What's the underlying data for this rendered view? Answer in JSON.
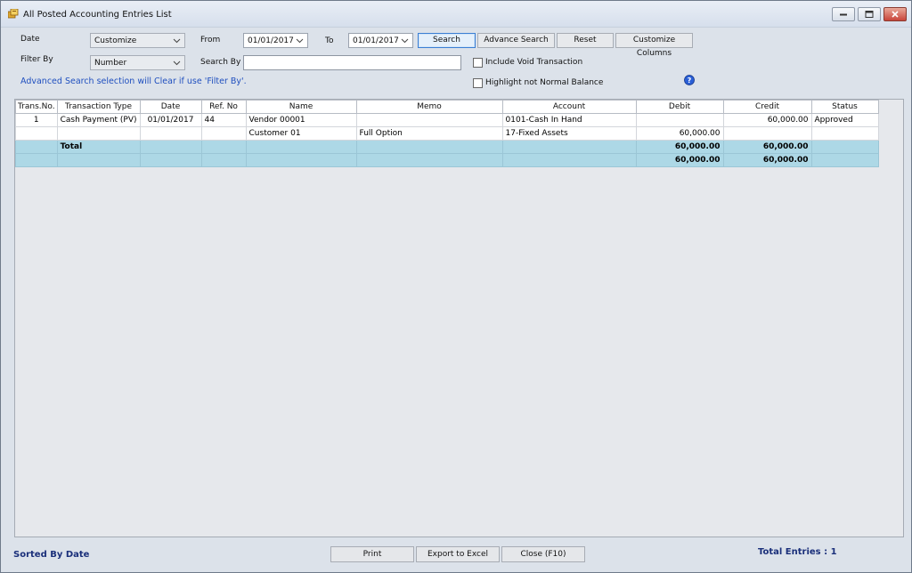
{
  "window": {
    "title": "All Posted Accounting Entries List",
    "colors": {
      "total_row": "#add8e6",
      "link": "#1f4fbf",
      "status_text": "#1a2f7a"
    }
  },
  "filters": {
    "date_label": "Date",
    "date_value": "Customize",
    "from_label": "From",
    "from_value": "01/01/2017",
    "to_label": "To",
    "to_value": "01/01/2017",
    "search_button": "Search",
    "advance_search_button": "Advance Search",
    "reset_button": "Reset",
    "customize_columns_button": "Customize Columns",
    "filter_by_label": "Filter By",
    "filter_by_value": "Number",
    "search_by_label": "Search By",
    "search_by_value": "",
    "include_void_label": "Include Void Transaction",
    "include_void_checked": false,
    "highlight_label": "Highlight not Normal Balance",
    "highlight_checked": false,
    "advanced_note": "Advanced Search selection will Clear if use 'Filter By'."
  },
  "grid": {
    "columns": [
      "Trans.No.",
      "Transaction Type",
      "Date",
      "Ref. No",
      "Name",
      "Memo",
      "Account",
      "Debit",
      "Credit",
      "Status"
    ],
    "rows": [
      {
        "trans_no": "1",
        "type": "Cash Payment (PV)",
        "date": "01/01/2017",
        "ref": "44",
        "name": "Vendor 00001",
        "memo": "",
        "account": "0101-Cash In Hand",
        "debit": "",
        "credit": "60,000.00",
        "status": "Approved"
      },
      {
        "trans_no": "",
        "type": "",
        "date": "",
        "ref": "",
        "name": "Customer 01",
        "memo": "Full Option",
        "account": "17-Fixed Assets",
        "debit": "60,000.00",
        "credit": "",
        "status": ""
      }
    ],
    "total_label": "Total",
    "totals": [
      {
        "debit": "60,000.00",
        "credit": "60,000.00"
      },
      {
        "debit": "60,000.00",
        "credit": "60,000.00"
      }
    ]
  },
  "footer": {
    "sorted_by": "Sorted By Date",
    "print_button": "Print",
    "export_button": "Export to Excel",
    "close_button": "Close (F10)",
    "total_entries": "Total Entries : 1"
  }
}
